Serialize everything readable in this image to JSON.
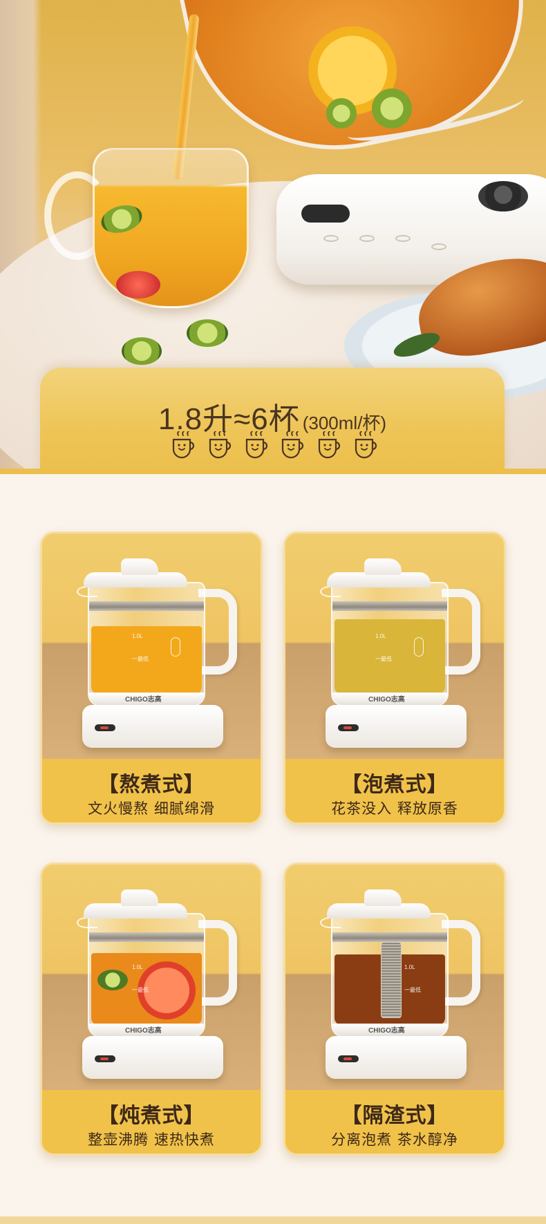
{
  "hero": {
    "capacity_main": "1.8升≈6杯",
    "capacity_note": "(300ml/杯)",
    "cup_count": 6,
    "kettle_scale_top": "1.0L",
    "kettle_brand": "CHIGO志高"
  },
  "modes": [
    {
      "title": "【熬煮式】",
      "desc": "文火慢熬 细腻绵滑",
      "liquid_color": "#f3a81c",
      "scale_top": "1.0L",
      "scale_low": "一最低",
      "brand": "CHIGO志高"
    },
    {
      "title": "【泡煮式】",
      "desc": "花茶没入 释放原香",
      "liquid_color": "#d9b53a",
      "scale_top": "1.0L",
      "scale_low": "一最低",
      "brand": "CHIGO志高"
    },
    {
      "title": "【炖煮式】",
      "desc": "整壶沸腾 速热快煮",
      "liquid_color": "#e98a1a",
      "scale_top": "1.0L",
      "scale_low": "一最低",
      "brand": "CHIGO志高"
    },
    {
      "title": "【隔渣式】",
      "desc": "分离泡煮 茶水醇净",
      "liquid_color": "#8a3d12",
      "scale_top": "1.0L",
      "scale_low": "一最低",
      "brand": "CHIGO志高"
    }
  ],
  "colors": {
    "banner": "#eec558",
    "card": "#f0c24a",
    "text": "#3d2818",
    "page_bg": "#fbf4ec"
  }
}
